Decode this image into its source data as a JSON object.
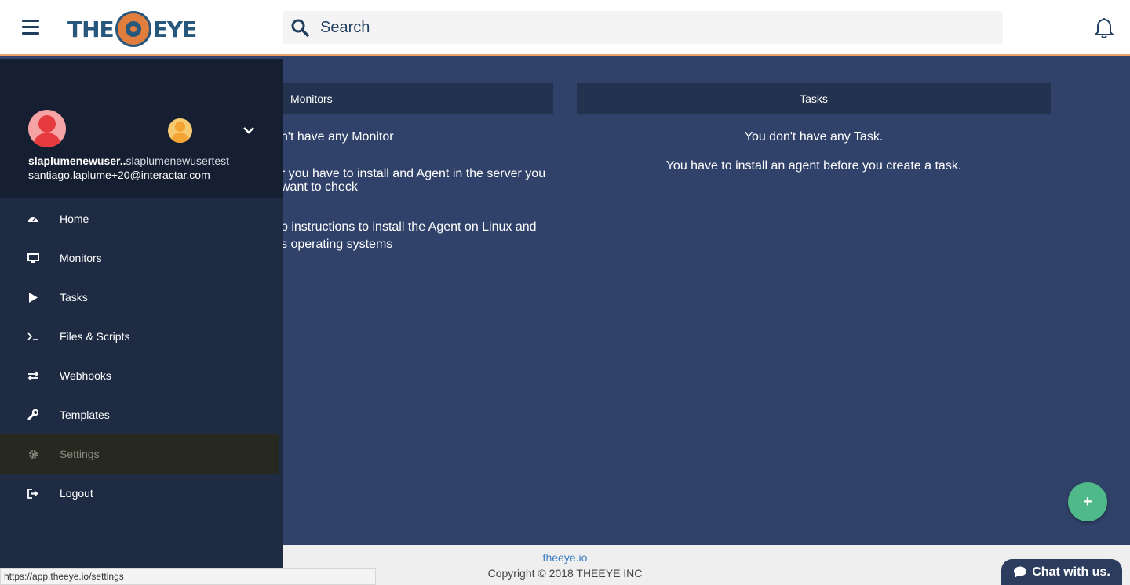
{
  "header": {
    "logo_left": "THE",
    "logo_right": "EYE",
    "search_placeholder": "Search"
  },
  "monitors": {
    "title": "Monitors",
    "line1": "n't have any Monitor",
    "line2a": "r you have to install and Agent in the server you",
    "line2b": "want to check",
    "line3a": "p instructions to install the Agent on Linux and",
    "line3b": "s operating systems"
  },
  "tasks": {
    "title": "Tasks",
    "line1": "You don't have any Task.",
    "line2": "You have to install an agent before you create a task."
  },
  "sidebar": {
    "user_name": "slaplumenewuser..",
    "org_name": "slaplumenewusertest",
    "email": "santiago.laplume+20@interactar.com",
    "items": [
      {
        "label": "Home",
        "icon": "dashboard-icon"
      },
      {
        "label": "Monitors",
        "icon": "desktop-icon"
      },
      {
        "label": "Tasks",
        "icon": "play-icon"
      },
      {
        "label": "Files & Scripts",
        "icon": "terminal-icon"
      },
      {
        "label": "Webhooks",
        "icon": "exchange-icon"
      },
      {
        "label": "Templates",
        "icon": "wrench-icon"
      },
      {
        "label": "Settings",
        "icon": "gear-icon",
        "active": true
      },
      {
        "label": "Logout",
        "icon": "sign-out-icon"
      }
    ]
  },
  "footer": {
    "link": "theeye.io",
    "copyright": "Copyright © 2018 THEEYE INC"
  },
  "fab_label": "+",
  "chat_label": "Chat with us.",
  "status_url": "https://app.theeye.io/settings",
  "colors": {
    "accent_orange": "#e9a36a",
    "sidebar_bg": "#1e2b43",
    "main_bg": "#31426a",
    "fab_green": "#4fb98a"
  }
}
